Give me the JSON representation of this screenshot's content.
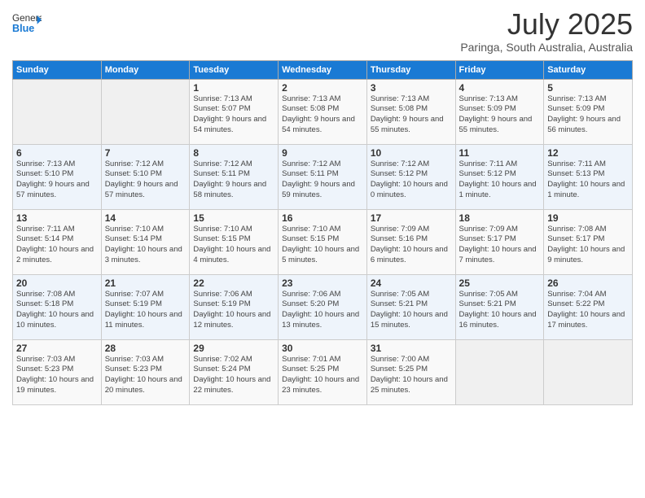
{
  "logo": {
    "general": "General",
    "blue": "Blue"
  },
  "header": {
    "month_year": "July 2025",
    "location": "Paringa, South Australia, Australia"
  },
  "days_of_week": [
    "Sunday",
    "Monday",
    "Tuesday",
    "Wednesday",
    "Thursday",
    "Friday",
    "Saturday"
  ],
  "weeks": [
    [
      {
        "day": "",
        "info": ""
      },
      {
        "day": "",
        "info": ""
      },
      {
        "day": "1",
        "info": "Sunrise: 7:13 AM\nSunset: 5:07 PM\nDaylight: 9 hours and 54 minutes."
      },
      {
        "day": "2",
        "info": "Sunrise: 7:13 AM\nSunset: 5:08 PM\nDaylight: 9 hours and 54 minutes."
      },
      {
        "day": "3",
        "info": "Sunrise: 7:13 AM\nSunset: 5:08 PM\nDaylight: 9 hours and 55 minutes."
      },
      {
        "day": "4",
        "info": "Sunrise: 7:13 AM\nSunset: 5:09 PM\nDaylight: 9 hours and 55 minutes."
      },
      {
        "day": "5",
        "info": "Sunrise: 7:13 AM\nSunset: 5:09 PM\nDaylight: 9 hours and 56 minutes."
      }
    ],
    [
      {
        "day": "6",
        "info": "Sunrise: 7:13 AM\nSunset: 5:10 PM\nDaylight: 9 hours and 57 minutes."
      },
      {
        "day": "7",
        "info": "Sunrise: 7:12 AM\nSunset: 5:10 PM\nDaylight: 9 hours and 57 minutes."
      },
      {
        "day": "8",
        "info": "Sunrise: 7:12 AM\nSunset: 5:11 PM\nDaylight: 9 hours and 58 minutes."
      },
      {
        "day": "9",
        "info": "Sunrise: 7:12 AM\nSunset: 5:11 PM\nDaylight: 9 hours and 59 minutes."
      },
      {
        "day": "10",
        "info": "Sunrise: 7:12 AM\nSunset: 5:12 PM\nDaylight: 10 hours and 0 minutes."
      },
      {
        "day": "11",
        "info": "Sunrise: 7:11 AM\nSunset: 5:12 PM\nDaylight: 10 hours and 1 minute."
      },
      {
        "day": "12",
        "info": "Sunrise: 7:11 AM\nSunset: 5:13 PM\nDaylight: 10 hours and 1 minute."
      }
    ],
    [
      {
        "day": "13",
        "info": "Sunrise: 7:11 AM\nSunset: 5:14 PM\nDaylight: 10 hours and 2 minutes."
      },
      {
        "day": "14",
        "info": "Sunrise: 7:10 AM\nSunset: 5:14 PM\nDaylight: 10 hours and 3 minutes."
      },
      {
        "day": "15",
        "info": "Sunrise: 7:10 AM\nSunset: 5:15 PM\nDaylight: 10 hours and 4 minutes."
      },
      {
        "day": "16",
        "info": "Sunrise: 7:10 AM\nSunset: 5:15 PM\nDaylight: 10 hours and 5 minutes."
      },
      {
        "day": "17",
        "info": "Sunrise: 7:09 AM\nSunset: 5:16 PM\nDaylight: 10 hours and 6 minutes."
      },
      {
        "day": "18",
        "info": "Sunrise: 7:09 AM\nSunset: 5:17 PM\nDaylight: 10 hours and 7 minutes."
      },
      {
        "day": "19",
        "info": "Sunrise: 7:08 AM\nSunset: 5:17 PM\nDaylight: 10 hours and 9 minutes."
      }
    ],
    [
      {
        "day": "20",
        "info": "Sunrise: 7:08 AM\nSunset: 5:18 PM\nDaylight: 10 hours and 10 minutes."
      },
      {
        "day": "21",
        "info": "Sunrise: 7:07 AM\nSunset: 5:19 PM\nDaylight: 10 hours and 11 minutes."
      },
      {
        "day": "22",
        "info": "Sunrise: 7:06 AM\nSunset: 5:19 PM\nDaylight: 10 hours and 12 minutes."
      },
      {
        "day": "23",
        "info": "Sunrise: 7:06 AM\nSunset: 5:20 PM\nDaylight: 10 hours and 13 minutes."
      },
      {
        "day": "24",
        "info": "Sunrise: 7:05 AM\nSunset: 5:21 PM\nDaylight: 10 hours and 15 minutes."
      },
      {
        "day": "25",
        "info": "Sunrise: 7:05 AM\nSunset: 5:21 PM\nDaylight: 10 hours and 16 minutes."
      },
      {
        "day": "26",
        "info": "Sunrise: 7:04 AM\nSunset: 5:22 PM\nDaylight: 10 hours and 17 minutes."
      }
    ],
    [
      {
        "day": "27",
        "info": "Sunrise: 7:03 AM\nSunset: 5:23 PM\nDaylight: 10 hours and 19 minutes."
      },
      {
        "day": "28",
        "info": "Sunrise: 7:03 AM\nSunset: 5:23 PM\nDaylight: 10 hours and 20 minutes."
      },
      {
        "day": "29",
        "info": "Sunrise: 7:02 AM\nSunset: 5:24 PM\nDaylight: 10 hours and 22 minutes."
      },
      {
        "day": "30",
        "info": "Sunrise: 7:01 AM\nSunset: 5:25 PM\nDaylight: 10 hours and 23 minutes."
      },
      {
        "day": "31",
        "info": "Sunrise: 7:00 AM\nSunset: 5:25 PM\nDaylight: 10 hours and 25 minutes."
      },
      {
        "day": "",
        "info": ""
      },
      {
        "day": "",
        "info": ""
      }
    ]
  ]
}
